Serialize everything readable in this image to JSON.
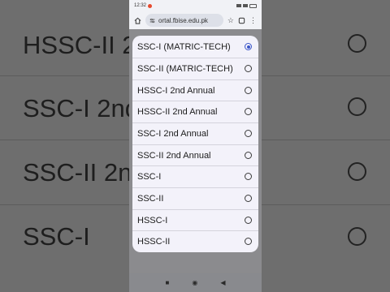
{
  "background_rows": [
    {
      "label": "HSSC-II 2"
    },
    {
      "label": "SSC-I 2nd"
    },
    {
      "label": "SSC-II 2n"
    },
    {
      "label": "SSC-I"
    }
  ],
  "status_bar": {
    "time": "12:32"
  },
  "browser": {
    "url": "ortal.fbise.edu.pk"
  },
  "dropdown": {
    "options": [
      {
        "label": "SSC-I (MATRIC-TECH)",
        "selected": true
      },
      {
        "label": "SSC-II (MATRIC-TECH)",
        "selected": false
      },
      {
        "label": "HSSC-I 2nd Annual",
        "selected": false
      },
      {
        "label": "HSSC-II 2nd Annual",
        "selected": false
      },
      {
        "label": "SSC-I 2nd Annual",
        "selected": false
      },
      {
        "label": "SSC-II 2nd Annual",
        "selected": false
      },
      {
        "label": "SSC-I",
        "selected": false
      },
      {
        "label": "SSC-II",
        "selected": false
      },
      {
        "label": "HSSC-I",
        "selected": false
      },
      {
        "label": "HSSC-II",
        "selected": false
      }
    ]
  },
  "colors": {
    "accent": "#3a55c8",
    "sheet_bg": "#f3f2fa",
    "scrim": "#8a8a8d"
  }
}
